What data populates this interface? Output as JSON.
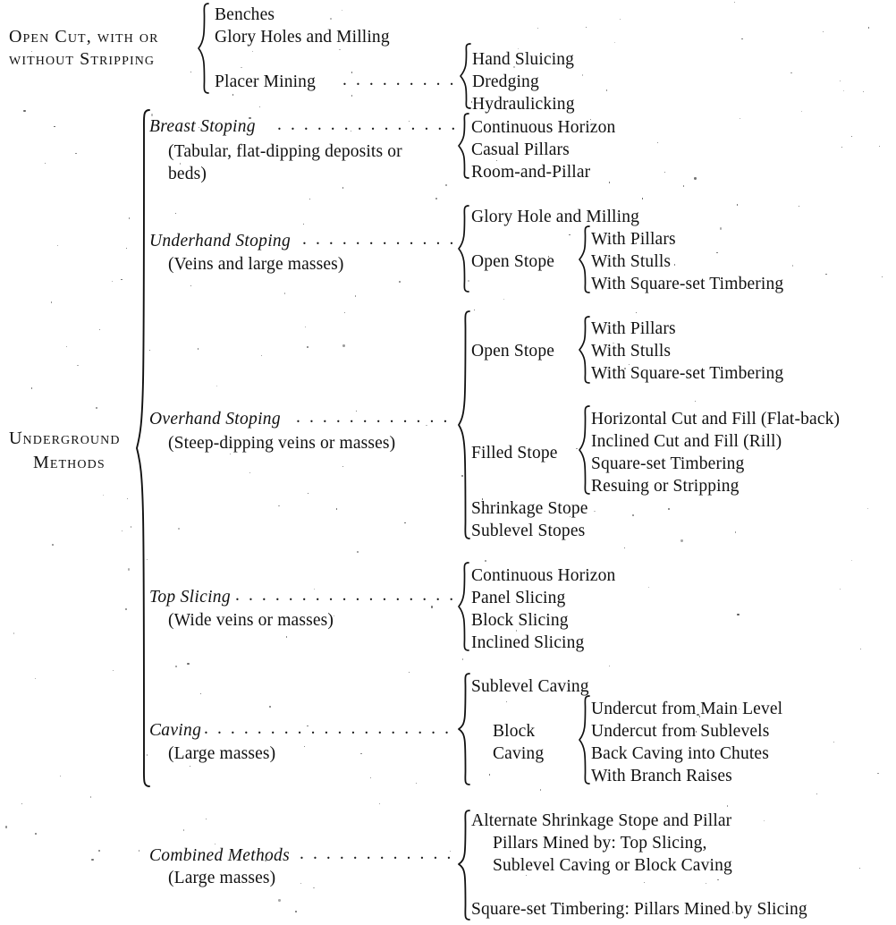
{
  "document": {
    "type": "classification-table",
    "subject": "Classification of Mining Methods",
    "background_color": "#ffffff",
    "ink_color": "#111111"
  },
  "leader_dots": ". . . . . . . . . . . . . . . . . . . . . . . . . . . . . . . . . . . . . . .",
  "groups": [
    {
      "id": "open-cut",
      "label_lines": [
        "Open Cut, with or",
        "without Stripping"
      ],
      "label_style": "small-caps",
      "children": [
        {
          "label": "Benches",
          "leader": false,
          "children": []
        },
        {
          "label": "Glory Holes and Milling",
          "leader": false,
          "children": []
        },
        {
          "label": "Placer Mining",
          "leader": true,
          "children": [
            {
              "label": "Hand Sluicing"
            },
            {
              "label": "Dredging"
            },
            {
              "label": "Hydraulicking"
            }
          ]
        }
      ]
    },
    {
      "id": "underground",
      "label_lines": [
        "Underground",
        "Methods"
      ],
      "label_style": "small-caps",
      "children": [
        {
          "id": "breast-stoping",
          "label": "Breast Stoping",
          "label_style": "italic",
          "leader": true,
          "qualifier_lines": [
            "(Tabular, flat-dipping deposits or",
            "beds)"
          ],
          "children": [
            {
              "label": "Continuous Horizon"
            },
            {
              "label": "Casual Pillars"
            },
            {
              "label": "Room-and-Pillar"
            }
          ]
        },
        {
          "id": "underhand-stoping",
          "label": "Underhand Stoping",
          "label_style": "italic",
          "leader": true,
          "qualifier_lines": [
            "(Veins and large masses)"
          ],
          "children": [
            {
              "label": "Glory Hole and Milling",
              "children": []
            },
            {
              "label": "Open Stope",
              "children": [
                {
                  "label": "With Pillars"
                },
                {
                  "label": "With Stulls"
                },
                {
                  "label": "With Square-set Timbering"
                }
              ]
            }
          ]
        },
        {
          "id": "overhand-stoping",
          "label": "Overhand Stoping",
          "label_style": "italic",
          "leader": true,
          "qualifier_lines": [
            "(Steep-dipping veins or masses)"
          ],
          "children": [
            {
              "label": "Open Stope",
              "children": [
                {
                  "label": "With Pillars"
                },
                {
                  "label": "With Stulls"
                },
                {
                  "label": "With Square-set Timbering"
                }
              ]
            },
            {
              "label": "Filled Stope",
              "children": [
                {
                  "label": "Horizontal Cut and Fill (Flat-back)"
                },
                {
                  "label": "Inclined Cut and Fill (Rill)"
                },
                {
                  "label": "Square-set Timbering"
                },
                {
                  "label": "Resuing or Stripping"
                }
              ]
            },
            {
              "label": "Shrinkage Stope",
              "children": []
            },
            {
              "label": "Sublevel Stopes",
              "children": []
            }
          ]
        },
        {
          "id": "top-slicing",
          "label": "Top Slicing",
          "label_style": "italic",
          "leader": true,
          "qualifier_lines": [
            "(Wide veins or masses)"
          ],
          "children": [
            {
              "label": "Continuous Horizon"
            },
            {
              "label": "Panel Slicing"
            },
            {
              "label": "Block Slicing"
            },
            {
              "label": "Inclined Slicing"
            }
          ]
        },
        {
          "id": "caving",
          "label": "Caving",
          "label_style": "italic",
          "leader": true,
          "qualifier_lines": [
            "(Large masses)"
          ],
          "children": [
            {
              "label": "Sublevel Caving",
              "children": []
            },
            {
              "label_lines": [
                "Block",
                "Caving"
              ],
              "children": [
                {
                  "label": "Undercut from Main Level"
                },
                {
                  "label": "Undercut from Sublevels"
                },
                {
                  "label": "Back Caving into Chutes"
                },
                {
                  "label": "With Branch Raises"
                }
              ]
            }
          ]
        },
        {
          "id": "combined-methods",
          "label": "Combined Methods",
          "label_style": "italic",
          "leader": true,
          "qualifier_lines": [
            "(Large masses)"
          ],
          "children": [
            {
              "label": "Alternate Shrinkage Stope and Pillar"
            },
            {
              "label": "Pillars Mined by: Top Slicing,"
            },
            {
              "label": "Sublevel Caving or Block Caving"
            },
            {
              "label": "Square-set Timbering: Pillars Mined by Slicing"
            }
          ]
        }
      ]
    }
  ]
}
